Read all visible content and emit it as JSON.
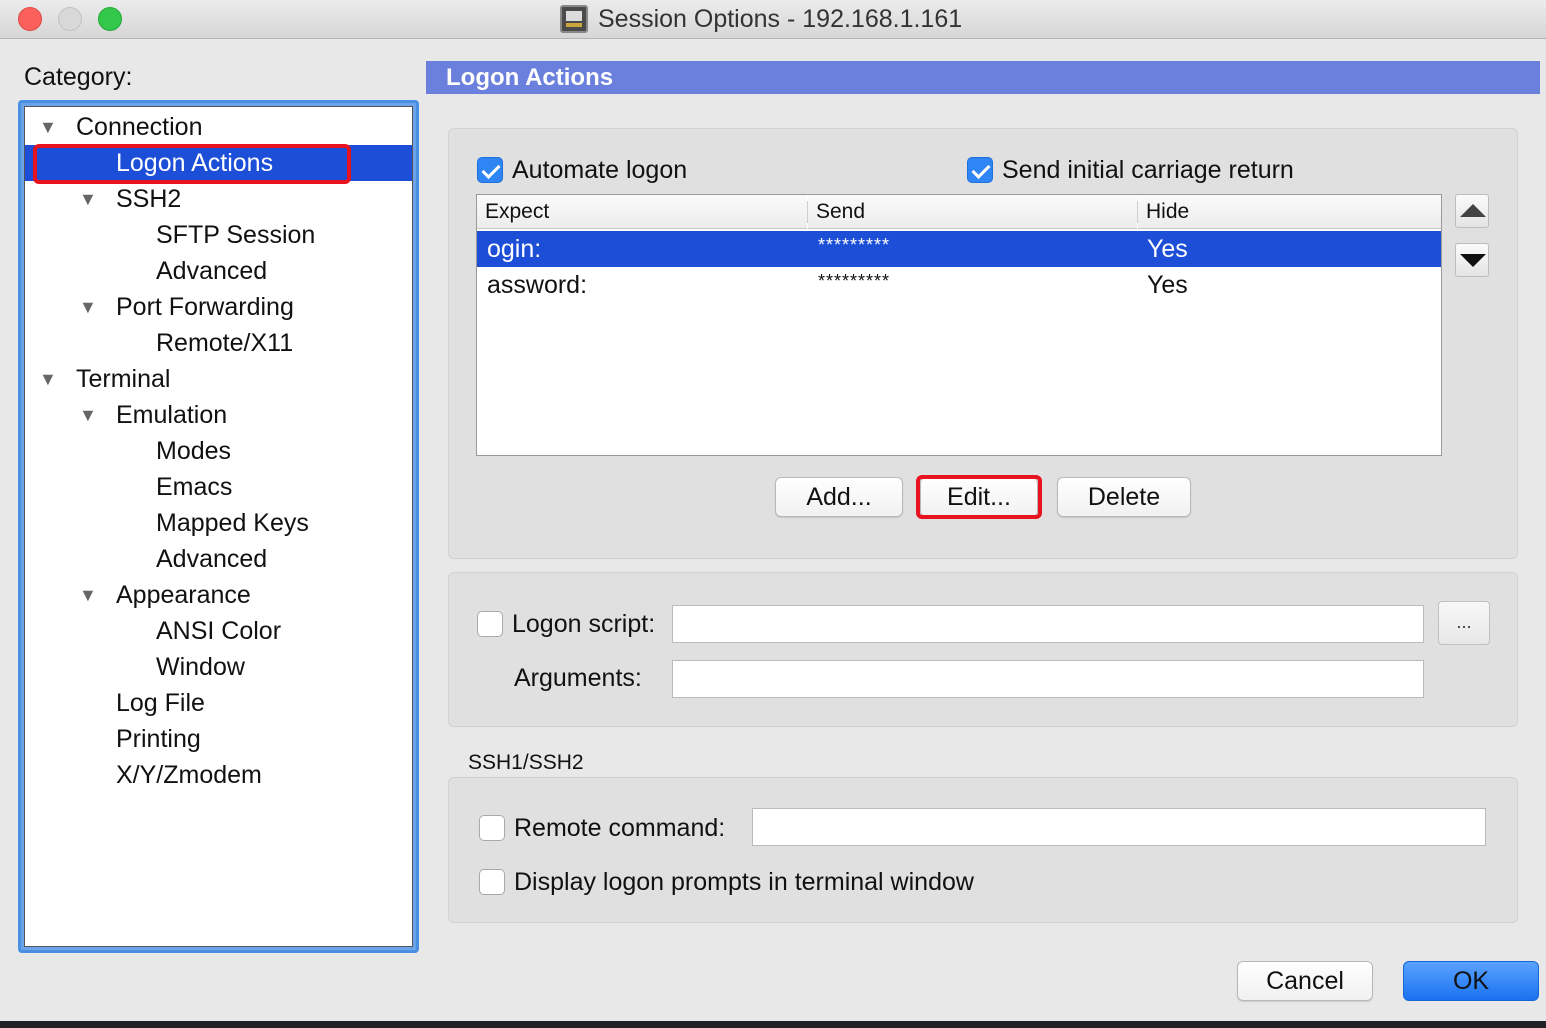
{
  "window": {
    "title": "Session Options - 192.168.1.161"
  },
  "category": {
    "label": "Category:",
    "items": [
      {
        "label": "Connection",
        "level": 0,
        "expandable": true,
        "selected": false
      },
      {
        "label": "Logon Actions",
        "level": 1,
        "expandable": false,
        "selected": true
      },
      {
        "label": "SSH2",
        "level": 1,
        "expandable": true,
        "selected": false
      },
      {
        "label": "SFTP Session",
        "level": 2,
        "expandable": false,
        "selected": false
      },
      {
        "label": "Advanced",
        "level": 2,
        "expandable": false,
        "selected": false
      },
      {
        "label": "Port Forwarding",
        "level": 1,
        "expandable": true,
        "selected": false
      },
      {
        "label": "Remote/X11",
        "level": 2,
        "expandable": false,
        "selected": false
      },
      {
        "label": "Terminal",
        "level": 0,
        "expandable": true,
        "selected": false
      },
      {
        "label": "Emulation",
        "level": 1,
        "expandable": true,
        "selected": false
      },
      {
        "label": "Modes",
        "level": 2,
        "expandable": false,
        "selected": false
      },
      {
        "label": "Emacs",
        "level": 2,
        "expandable": false,
        "selected": false
      },
      {
        "label": "Mapped Keys",
        "level": 2,
        "expandable": false,
        "selected": false
      },
      {
        "label": "Advanced",
        "level": 2,
        "expandable": false,
        "selected": false
      },
      {
        "label": "Appearance",
        "level": 1,
        "expandable": true,
        "selected": false
      },
      {
        "label": "ANSI Color",
        "level": 2,
        "expandable": false,
        "selected": false
      },
      {
        "label": "Window",
        "level": 2,
        "expandable": false,
        "selected": false
      },
      {
        "label": "Log File",
        "level": 1,
        "expandable": false,
        "selected": false
      },
      {
        "label": "Printing",
        "level": 1,
        "expandable": false,
        "selected": false
      },
      {
        "label": "X/Y/Zmodem",
        "level": 1,
        "expandable": false,
        "selected": false
      }
    ]
  },
  "section": {
    "title": "Logon Actions"
  },
  "logon": {
    "automate_label": "Automate logon",
    "automate_checked": true,
    "send_cr_label": "Send initial carriage return",
    "send_cr_checked": true,
    "columns": [
      "Expect",
      "Send",
      "Hide"
    ],
    "rows": [
      {
        "expect": "ogin:",
        "send": "*********",
        "hide": "Yes",
        "selected": true
      },
      {
        "expect": "assword:",
        "send": "*********",
        "hide": "Yes",
        "selected": false
      }
    ],
    "add_label": "Add...",
    "edit_label": "Edit...",
    "delete_label": "Delete"
  },
  "script": {
    "logon_script_label": "Logon script:",
    "logon_script_checked": false,
    "logon_script_value": "",
    "browse_label": "...",
    "arguments_label": "Arguments:",
    "arguments_value": ""
  },
  "ssh": {
    "group_label": "SSH1/SSH2",
    "remote_command_label": "Remote command:",
    "remote_command_checked": false,
    "remote_command_value": "",
    "display_prompts_label": "Display logon prompts in terminal window",
    "display_prompts_checked": false
  },
  "footer": {
    "cancel_label": "Cancel",
    "ok_label": "OK"
  },
  "colors": {
    "selection": "#1d4ed8",
    "header": "#6b7fdc",
    "highlight_outline": "#e8131e",
    "checkbox_checked": "#2f85f3",
    "ok_button": "#1a72f0"
  }
}
